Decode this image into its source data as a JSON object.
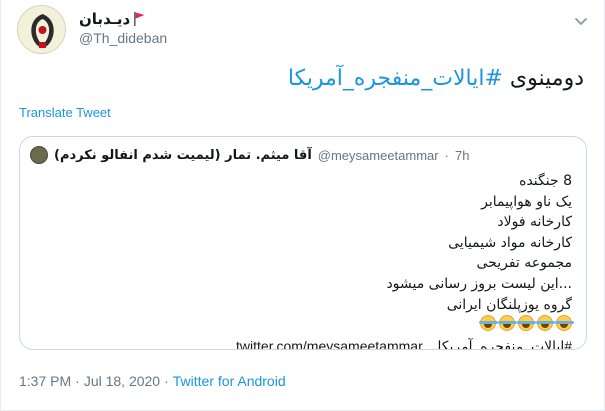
{
  "author": {
    "display_name": "دیـدبان",
    "handle": "@Th_dideban"
  },
  "tweet": {
    "text_prefix": "دومینوی ",
    "hashtag": "#ایالات_منفجره_آمریکا"
  },
  "translate_label": "Translate Tweet",
  "quoted": {
    "display_name": "آقا میثم. تمار (لیمیت شدم انفالو نکردم)",
    "handle": "@meysameetammar",
    "separator": "·",
    "time": "7h",
    "lines": [
      "8 جنگنده",
      "یک ناو هواپیمابر",
      "کارخانه فولاد",
      "کارخانه مواد شیمیایی",
      "مجموعه تفریحی",
      "...این لیست بروز رسانی میشود",
      "گروه یوزپلنگان ایرانی"
    ],
    "emoji_count": 5,
    "emoji_name": "face-with-tears-of-joy",
    "last_hashtag": "#ایالات_منفجره_آمریکا",
    "last_link": "twitter.com/meysameetammar..."
  },
  "meta": {
    "time": "1:37 PM",
    "separator1": "·",
    "date": "Jul 18, 2020",
    "separator2": "·",
    "source": "Twitter for Android"
  },
  "colors": {
    "link": "#1b95e0",
    "muted": "#657786",
    "text": "#14171a",
    "border": "#ccd6dd"
  }
}
